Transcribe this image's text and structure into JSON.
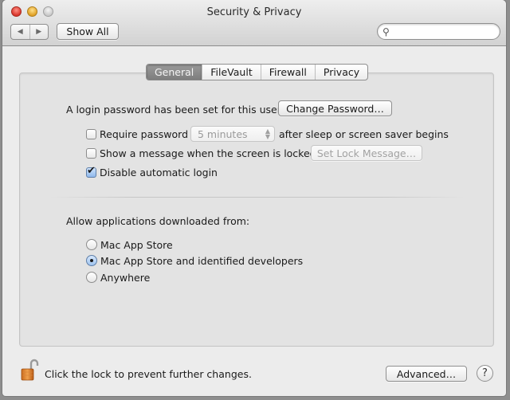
{
  "window": {
    "title": "Security & Privacy"
  },
  "toolbar": {
    "back_icon": "triangle-left",
    "forward_icon": "triangle-right",
    "show_all_label": "Show All",
    "search_placeholder": "",
    "search_value": ""
  },
  "tabs": [
    {
      "label": "General",
      "active": true
    },
    {
      "label": "FileVault",
      "active": false
    },
    {
      "label": "Firewall",
      "active": false
    },
    {
      "label": "Privacy",
      "active": false
    }
  ],
  "general": {
    "password_status": "A login password has been set for this user",
    "change_password_label": "Change Password…",
    "require_password": {
      "label": "Require password",
      "checked": false,
      "delay_value": "5 minutes",
      "suffix": "after sleep or screen saver begins"
    },
    "show_message": {
      "label": "Show a message when the screen is locked",
      "checked": false,
      "button_label": "Set Lock Message…"
    },
    "disable_auto_login": {
      "label": "Disable automatic login",
      "checked": true
    },
    "allow_apps_heading": "Allow applications downloaded from:",
    "allow_apps_options": [
      {
        "label": "Mac App Store",
        "selected": false
      },
      {
        "label": "Mac App Store and identified developers",
        "selected": true
      },
      {
        "label": "Anywhere",
        "selected": false
      }
    ]
  },
  "footer": {
    "lock_icon": "unlocked-padlock",
    "lock_message": "Click the lock to prevent further changes.",
    "advanced_label": "Advanced…",
    "help_label": "?"
  }
}
